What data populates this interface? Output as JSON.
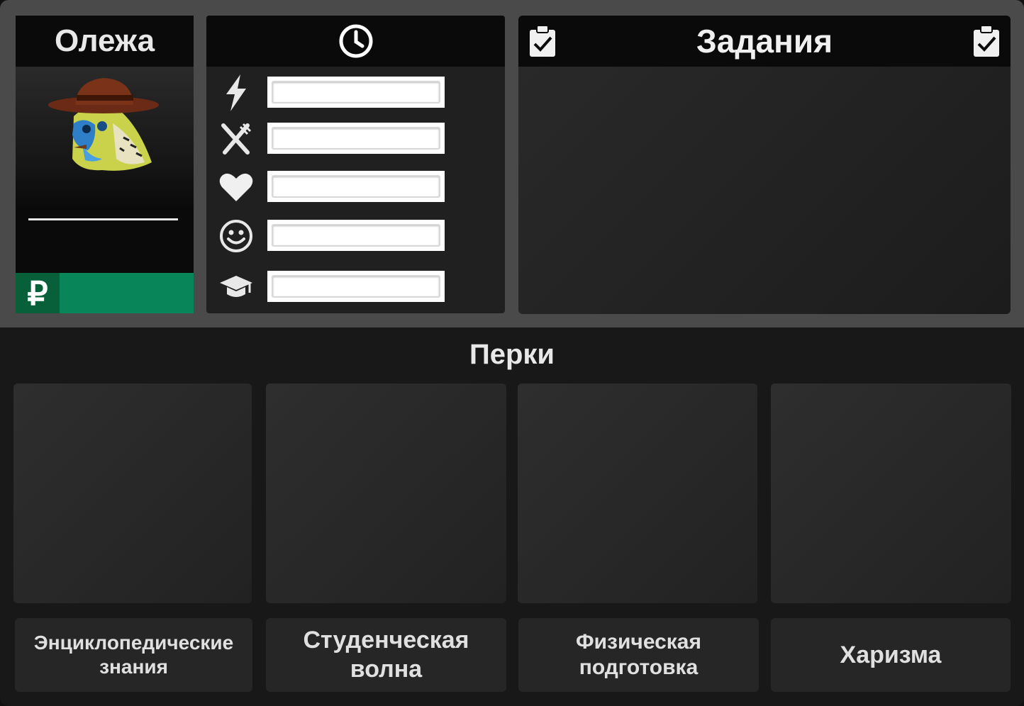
{
  "character": {
    "name": "Олежа",
    "currency_symbol": "₽",
    "money": ""
  },
  "stats": {
    "header_icon": "clock-icon",
    "items": [
      {
        "icon": "energy-icon",
        "value": 0
      },
      {
        "icon": "food-icon",
        "value": 0
      },
      {
        "icon": "health-icon",
        "value": 0
      },
      {
        "icon": "mood-icon",
        "value": 0
      },
      {
        "icon": "education-icon",
        "value": 0
      }
    ]
  },
  "tasks": {
    "title": "Задания",
    "icon": "clipboard-check-icon"
  },
  "perks": {
    "title": "Перки",
    "items": [
      {
        "label": "Энциклопедические знания"
      },
      {
        "label": "Студенческая волна"
      },
      {
        "label": "Физическая подготовка"
      },
      {
        "label": "Харизма"
      }
    ]
  },
  "colors": {
    "money_bar": "#08865a",
    "money_icon_bg": "#07603a",
    "top_area": "#4a4a4a",
    "panel_header": "#0a0a0a"
  }
}
